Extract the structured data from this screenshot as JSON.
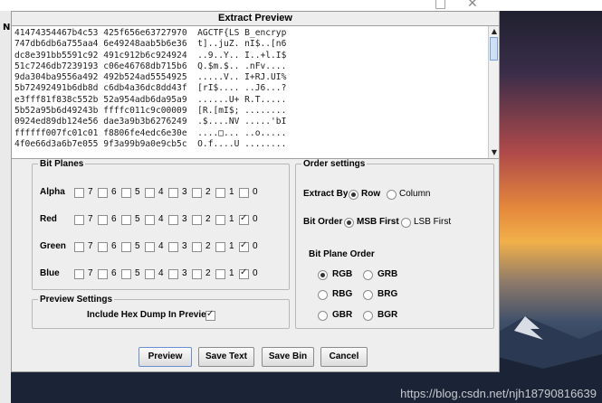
{
  "dialog": {
    "title": "Extract Preview"
  },
  "left_strip_text": "N",
  "preview_lines": [
    "41474354467b4c53 425f656e63727970  AGCTF{LS B_encryp",
    "747db6db6a755aa4 6e49248aab5b6e36  t]..juZ. nI$..[n6",
    "dc8e391bb5591c92 491c912b6c924924  ..9..Y.. I..+l.I$",
    "51c7246db7239193 c06e46768db715b6  Q.$m.$.. .nFv....",
    "9da304ba9556a492 492b524ad5554925  .....V.. I+RJ.UI%",
    "5b72492491b6db8d c6db4a36dc8dd43f  [rI$.... ..J6...?",
    "e3fff81f838c552b 52a954adb6da95a9  ......U+ R.T.....",
    "5b52a95b6d49243b ffffc011c9c00009  [R.[mI$; ........",
    "0924ed89db124e56 dae3a9b3b6276249  .$....NV .....'bI",
    "ffffff007fc01c01 f8806fe4edc6e30e  ....□... ..o.....",
    "4f0e66d3a6b7e055 9f3a99b9a0e9cb5c  O.f....U ........"
  ],
  "bit_planes": {
    "legend": "Bit Planes",
    "bit_labels": [
      "7",
      "6",
      "5",
      "4",
      "3",
      "2",
      "1",
      "0"
    ],
    "channels": [
      {
        "name": "Alpha",
        "checked": [
          false,
          false,
          false,
          false,
          false,
          false,
          false,
          false
        ]
      },
      {
        "name": "Red",
        "checked": [
          false,
          false,
          false,
          false,
          false,
          false,
          false,
          true
        ]
      },
      {
        "name": "Green",
        "checked": [
          false,
          false,
          false,
          false,
          false,
          false,
          false,
          true
        ]
      },
      {
        "name": "Blue",
        "checked": [
          false,
          false,
          false,
          false,
          false,
          false,
          false,
          true
        ]
      }
    ]
  },
  "order_settings": {
    "legend": "Order settings",
    "extract_by_label": "Extract By",
    "extract_by_options": [
      {
        "label": "Row",
        "selected": true
      },
      {
        "label": "Column",
        "selected": false
      }
    ],
    "bit_order_label": "Bit Order",
    "bit_order_options": [
      {
        "label": "MSB First",
        "selected": true
      },
      {
        "label": "LSB First",
        "selected": false
      }
    ],
    "plane_order_label": "Bit Plane Order",
    "plane_order_options": [
      {
        "label": "RGB",
        "selected": true
      },
      {
        "label": "GRB",
        "selected": false
      },
      {
        "label": "RBG",
        "selected": false
      },
      {
        "label": "BRG",
        "selected": false
      },
      {
        "label": "GBR",
        "selected": false
      },
      {
        "label": "BGR",
        "selected": false
      }
    ]
  },
  "preview_settings": {
    "legend": "Preview Settings",
    "hex_dump_label": "Include Hex Dump In Preview",
    "hex_dump_checked": true
  },
  "buttons": {
    "preview": "Preview",
    "save_text": "Save Text",
    "save_bin": "Save Bin",
    "cancel": "Cancel"
  },
  "watermark": "https://blog.csdn.net/njh18790816639",
  "colors": {
    "dialog_bg": "#eeeeee",
    "selection_accent": "#6a8fd0"
  }
}
